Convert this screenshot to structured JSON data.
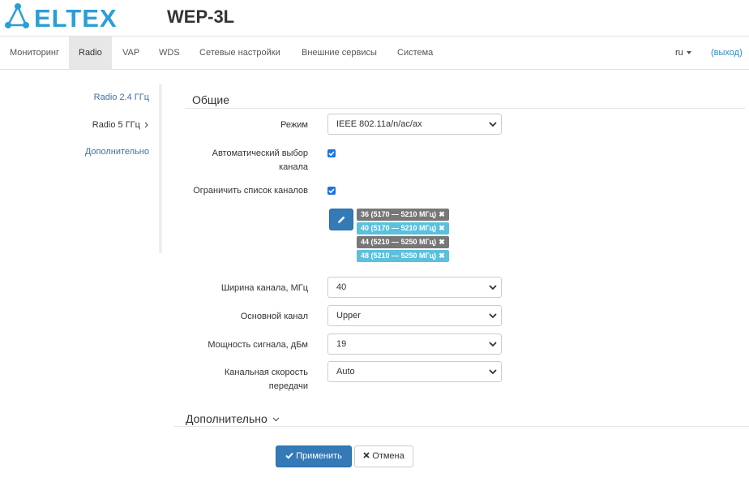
{
  "header": {
    "logo_text": "ELTEX",
    "model": "WEP-3L",
    "brand_color": "#2a9fd6"
  },
  "nav": {
    "items": [
      "Мониторинг",
      "Radio",
      "VAP",
      "WDS",
      "Сетевые настройки",
      "Внешние сервисы",
      "Система"
    ],
    "active": "Radio",
    "lang": "ru",
    "logout": "(выход)"
  },
  "sidebar": {
    "items": [
      {
        "label": "Radio 2.4 ГГц",
        "active": false
      },
      {
        "label": "Radio 5 ГГц",
        "active": true
      },
      {
        "label": "Дополнительно",
        "active": false
      }
    ]
  },
  "general": {
    "title": "Общие",
    "mode": {
      "label": "Режим",
      "value": "IEEE 802.11a/n/ac/ax"
    },
    "auto_channel": {
      "label_line1": "Автоматический выбор",
      "label_line2": "канала",
      "checked": true
    },
    "limit_channels": {
      "label": "Ограничить список каналов",
      "checked": true
    },
    "channels": [
      {
        "text": "36 (5170 — 5210 МГц)",
        "style": "dark"
      },
      {
        "text": "40 (5170 — 5210 МГц)",
        "style": "light"
      },
      {
        "text": "44 (5210 — 5250 МГц)",
        "style": "dark"
      },
      {
        "text": "48 (5210 — 5250 МГц)",
        "style": "light"
      }
    ],
    "tag_remove_glyph": "✖",
    "bandwidth": {
      "label": "Ширина канала, МГц",
      "value": "40"
    },
    "primary_channel": {
      "label": "Основной канал",
      "value": "Upper"
    },
    "power": {
      "label": "Мощность сигнала, дБм",
      "value": "19"
    },
    "rate": {
      "label_line1": "Канальная скорость",
      "label_line2": "передачи",
      "value": "Auto"
    }
  },
  "advanced": {
    "title": "Дополнительно"
  },
  "actions": {
    "apply": "Применить",
    "cancel": "Отмена"
  },
  "icons": {
    "logo": "eltex-network-icon",
    "edit": "pencil-icon",
    "apply": "check-icon",
    "cancel": "times-icon"
  },
  "colors": {
    "primary": "#337ab7",
    "tag_dark": "#777777",
    "tag_light": "#5bc0de",
    "link": "#3b72a8",
    "checkbox": "#1a73e8"
  }
}
